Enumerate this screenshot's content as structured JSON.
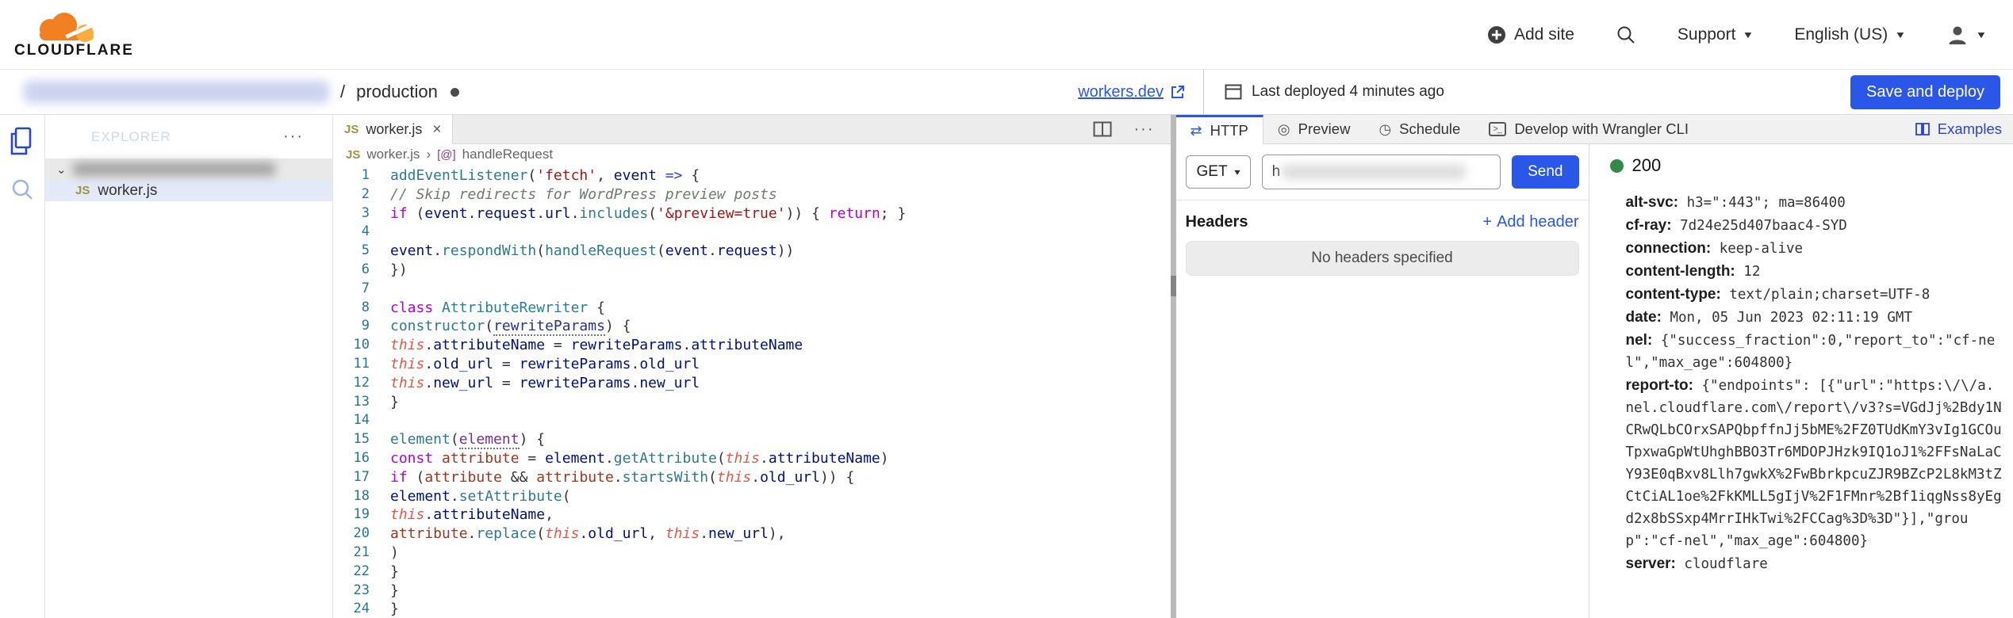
{
  "colors": {
    "accent": "#2b57e8",
    "status_green": "#318a47",
    "logo_orange": "#f38020",
    "logo_light_orange": "#faad3f"
  },
  "icons": {
    "close": "×",
    "more": "···",
    "plus": "+",
    "caret_down": "▼",
    "select_caret": "▾",
    "chevron_right": "›",
    "chevron_down": "⌄",
    "method_symbol": "[@]",
    "dot_menu": "···"
  },
  "topnav": {
    "logo_text": "CLOUDFLARE",
    "add_site": "Add site",
    "support": "Support",
    "language": "English (US)"
  },
  "breadcrumb": {
    "separator": "/",
    "environment": "production"
  },
  "deploybar": {
    "workers_dev": "workers.dev",
    "last_deployed": "Last deployed 4 minutes ago",
    "save_button": "Save and deploy"
  },
  "explorer": {
    "title": "EXPLORER",
    "file_badge": "JS",
    "file": "worker.js"
  },
  "editor": {
    "tab": {
      "badge": "JS",
      "label": "worker.js"
    },
    "breadcrumb": {
      "badge": "JS",
      "file": "worker.js",
      "symbol": "handleRequest"
    },
    "code_lines": [
      {
        "n": "1",
        "tokens": [
          [
            "fn",
            "addEventListener"
          ],
          [
            "p",
            "("
          ],
          [
            "s",
            "'fetch'"
          ],
          [
            "p",
            ", "
          ],
          [
            "v",
            "event"
          ],
          [
            "ar",
            " => "
          ],
          [
            "p",
            "{"
          ]
        ]
      },
      {
        "n": "2",
        "tokens": [
          [
            "c",
            "// Skip redirects for WordPress preview posts"
          ]
        ]
      },
      {
        "n": "3",
        "tokens": [
          [
            "kw",
            "if"
          ],
          [
            "p",
            " ("
          ],
          [
            "v",
            "event"
          ],
          [
            "p",
            "."
          ],
          [
            "v",
            "request"
          ],
          [
            "p",
            "."
          ],
          [
            "v",
            "url"
          ],
          [
            "p",
            "."
          ],
          [
            "fn",
            "includes"
          ],
          [
            "p",
            "("
          ],
          [
            "s",
            "'&preview=true'"
          ],
          [
            "p",
            ")) { "
          ],
          [
            "kw",
            "return"
          ],
          [
            "p",
            "; }"
          ]
        ]
      },
      {
        "n": "4",
        "tokens": []
      },
      {
        "n": "5",
        "tokens": [
          [
            "v",
            "event"
          ],
          [
            "p",
            "."
          ],
          [
            "fn",
            "respondWith"
          ],
          [
            "p",
            "("
          ],
          [
            "fn",
            "handleRequest"
          ],
          [
            "p",
            "("
          ],
          [
            "v",
            "event"
          ],
          [
            "p",
            "."
          ],
          [
            "v",
            "request"
          ],
          [
            "p",
            "))"
          ]
        ]
      },
      {
        "n": "6",
        "tokens": [
          [
            "p",
            "})"
          ]
        ]
      },
      {
        "n": "7",
        "tokens": []
      },
      {
        "n": "8",
        "tokens": [
          [
            "kw",
            "class"
          ],
          [
            "ty",
            " AttributeRewriter"
          ],
          [
            "p",
            " {"
          ]
        ]
      },
      {
        "n": "9",
        "tokens": [
          [
            "fn",
            "constructor"
          ],
          [
            "p",
            "("
          ],
          [
            "prv",
            "rewriteParams"
          ],
          [
            "p",
            ") {"
          ]
        ]
      },
      {
        "n": "10",
        "tokens": [
          [
            "th",
            "this"
          ],
          [
            "p",
            "."
          ],
          [
            "v",
            "attributeName"
          ],
          [
            "p",
            " = "
          ],
          [
            "v",
            "rewriteParams"
          ],
          [
            "p",
            "."
          ],
          [
            "v",
            "attributeName"
          ]
        ]
      },
      {
        "n": "11",
        "tokens": [
          [
            "th",
            "this"
          ],
          [
            "p",
            "."
          ],
          [
            "v",
            "old_url"
          ],
          [
            "p",
            " = "
          ],
          [
            "v",
            "rewriteParams"
          ],
          [
            "p",
            "."
          ],
          [
            "v",
            "old_url"
          ]
        ]
      },
      {
        "n": "12",
        "tokens": [
          [
            "th",
            "this"
          ],
          [
            "p",
            "."
          ],
          [
            "v",
            "new_url"
          ],
          [
            "p",
            " = "
          ],
          [
            "v",
            "rewriteParams"
          ],
          [
            "p",
            "."
          ],
          [
            "v",
            "new_url"
          ]
        ]
      },
      {
        "n": "13",
        "tokens": [
          [
            "p",
            "}"
          ]
        ]
      },
      {
        "n": "14",
        "tokens": []
      },
      {
        "n": "15",
        "tokens": [
          [
            "fn",
            "element"
          ],
          [
            "p",
            "("
          ],
          [
            "pr",
            "element"
          ],
          [
            "p",
            ") {"
          ]
        ]
      },
      {
        "n": "16",
        "tokens": [
          [
            "kw",
            "const"
          ],
          [
            "cv",
            " attribute"
          ],
          [
            "p",
            " = "
          ],
          [
            "v",
            "element"
          ],
          [
            "p",
            "."
          ],
          [
            "fn",
            "getAttribute"
          ],
          [
            "p",
            "("
          ],
          [
            "th",
            "this"
          ],
          [
            "p",
            "."
          ],
          [
            "v",
            "attributeName"
          ],
          [
            "p",
            ")"
          ]
        ]
      },
      {
        "n": "17",
        "tokens": [
          [
            "kw",
            "if"
          ],
          [
            "p",
            " ("
          ],
          [
            "cv",
            "attribute"
          ],
          [
            "p",
            " && "
          ],
          [
            "cv",
            "attribute"
          ],
          [
            "p",
            "."
          ],
          [
            "fn",
            "startsWith"
          ],
          [
            "p",
            "("
          ],
          [
            "th",
            "this"
          ],
          [
            "p",
            "."
          ],
          [
            "v",
            "old_url"
          ],
          [
            "p",
            ")) {"
          ]
        ]
      },
      {
        "n": "18",
        "tokens": [
          [
            "v",
            "element"
          ],
          [
            "p",
            "."
          ],
          [
            "fn",
            "setAttribute"
          ],
          [
            "p",
            "("
          ]
        ]
      },
      {
        "n": "19",
        "tokens": [
          [
            "th",
            "this"
          ],
          [
            "p",
            "."
          ],
          [
            "v",
            "attributeName"
          ],
          [
            "p",
            ","
          ]
        ]
      },
      {
        "n": "20",
        "tokens": [
          [
            "cv",
            "attribute"
          ],
          [
            "p",
            "."
          ],
          [
            "fn",
            "replace"
          ],
          [
            "p",
            "("
          ],
          [
            "th",
            "this"
          ],
          [
            "p",
            "."
          ],
          [
            "v",
            "old_url"
          ],
          [
            "p",
            ", "
          ],
          [
            "th",
            "this"
          ],
          [
            "p",
            "."
          ],
          [
            "v",
            "new_url"
          ],
          [
            "p",
            "),"
          ]
        ]
      },
      {
        "n": "21",
        "tokens": [
          [
            "p",
            ")"
          ]
        ]
      },
      {
        "n": "22",
        "tokens": [
          [
            "p",
            "}"
          ]
        ]
      },
      {
        "n": "23",
        "tokens": [
          [
            "p",
            "}"
          ]
        ]
      },
      {
        "n": "24",
        "tokens": [
          [
            "p",
            "}"
          ]
        ]
      }
    ]
  },
  "http_panel": {
    "tabs": [
      {
        "label": "HTTP",
        "icon": "http-arrows-icon",
        "glyph": "⇄",
        "active": true
      },
      {
        "label": "Preview",
        "icon": "preview-icon",
        "glyph": "◎",
        "active": false
      },
      {
        "label": "Schedule",
        "icon": "schedule-clock-icon",
        "glyph": "◷",
        "active": false
      },
      {
        "label": "Develop with Wrangler CLI",
        "icon": "terminal-icon",
        "glyph": ">_",
        "active": false
      }
    ],
    "examples": "Examples",
    "request": {
      "method": "GET",
      "url_lead": "h",
      "send": "Send",
      "headers_title": "Headers",
      "add_header": "Add header",
      "no_headers": "No headers specified"
    },
    "response": {
      "status": "200",
      "headers": [
        {
          "name": "alt-svc",
          "value": "h3=\":443\"; ma=86400"
        },
        {
          "name": "cf-ray",
          "value": "7d24e25d407baac4-SYD"
        },
        {
          "name": "connection",
          "value": "keep-alive"
        },
        {
          "name": "content-length",
          "value": "12"
        },
        {
          "name": "content-type",
          "value": "text/plain;charset=UTF-8"
        },
        {
          "name": "date",
          "value": "Mon, 05 Jun 2023 02:11:19 GMT"
        },
        {
          "name": "nel",
          "value": "{\"success_fraction\":0,\"report_to\":\"cf-nel\",\"max_age\":604800}"
        },
        {
          "name": "report-to",
          "value": "{\"endpoints\": [{\"url\":\"https:\\/\\/a.nel.cloudflare.com\\/report\\/v3?s=VGdJj%2Bdy1NCRwQLbCOrxSAPQbpffnJj5bME%2FZ0TUdKmY3vIg1GCOuTpxwaGpWtUhghBBO3Tr6MDOPJHzk9IQ1oJ1%2FFsNaLaCY93E0qBxv8Llh7gwkX%2FwBbrkpcuZJR9BZcP2L8kM3tZCtCiAL1oe%2FkKMLL5gIjV%2F1FMnr%2Bf1iqgNss8yEgd2x8bSSxp4MrrIHkTwi%2FCCag%3D%3D\"}],\"group\":\"cf-nel\",\"max_age\":604800}"
        },
        {
          "name": "server",
          "value": "cloudflare"
        }
      ]
    }
  }
}
